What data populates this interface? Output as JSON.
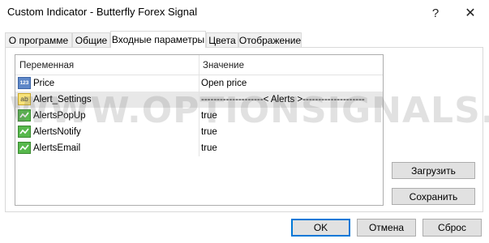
{
  "window": {
    "title": "Custom Indicator - Butterfly Forex Signal",
    "help_glyph": "?",
    "close_glyph": "✕"
  },
  "tabs": [
    {
      "label": "О программе"
    },
    {
      "label": "Общие"
    },
    {
      "label": "Входные параметры",
      "active": true
    },
    {
      "label": "Цвета"
    },
    {
      "label": "Отображение"
    }
  ],
  "grid": {
    "columns": [
      "Переменная",
      "Значение"
    ],
    "rows": [
      {
        "icon": "numeric-icon",
        "icon_text": "123",
        "name": "Price",
        "value": "Open price"
      },
      {
        "icon": "string-icon",
        "icon_text": "ab",
        "name": "Alert_Settings",
        "value": "--------------------< Alerts >--------------------",
        "selected": true
      },
      {
        "icon": "boolean-icon",
        "icon_text": "",
        "name": "AlertsPopUp",
        "value": "true"
      },
      {
        "icon": "boolean-icon",
        "icon_text": "",
        "name": "AlertsNotify",
        "value": "true"
      },
      {
        "icon": "boolean-icon",
        "icon_text": "",
        "name": "AlertsEmail",
        "value": "true"
      }
    ]
  },
  "watermark": "WWW.OPTIONSIGNALS.COM",
  "side_buttons": {
    "load": "Загрузить",
    "save": "Сохранить"
  },
  "footer": {
    "ok": "OK",
    "cancel": "Отмена",
    "reset": "Сброс"
  },
  "colors": {
    "accent": "#0078d7",
    "selected_row": "#e8e8e8",
    "numeric_icon": "#5f88c8",
    "string_icon": "#f7e27a",
    "boolean_icon": "#57b84c"
  }
}
